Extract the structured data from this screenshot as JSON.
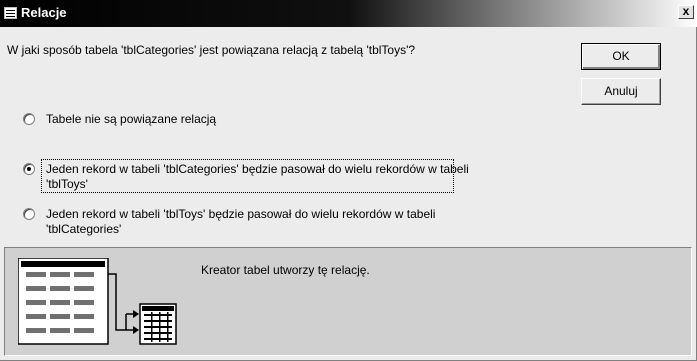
{
  "window": {
    "title": "Relacje",
    "close_label": "x"
  },
  "question": "W jaki sposób tabela 'tblCategories' jest powiązana relacją z tabelą 'tblToys'?",
  "buttons": {
    "ok_label": "OK",
    "cancel_label": "Anuluj"
  },
  "options": [
    {
      "label_lines": [
        "Tabele nie są powiązane relacją"
      ],
      "selected": false
    },
    {
      "label_lines": [
        "Jeden rekord w tabeli 'tblCategories' będzie pasował do wielu rekordów w tabeli",
        "'tblToys'"
      ],
      "selected": true
    },
    {
      "label_lines": [
        "Jeden rekord w tabeli 'tblToys' będzie pasował do wielu rekordów w tabeli",
        "'tblCategories'"
      ],
      "selected": false
    }
  ],
  "info_text": "Kreator tabel utworzy tę relację.",
  "diagram_icon": "one-to-many-relationship-icon"
}
